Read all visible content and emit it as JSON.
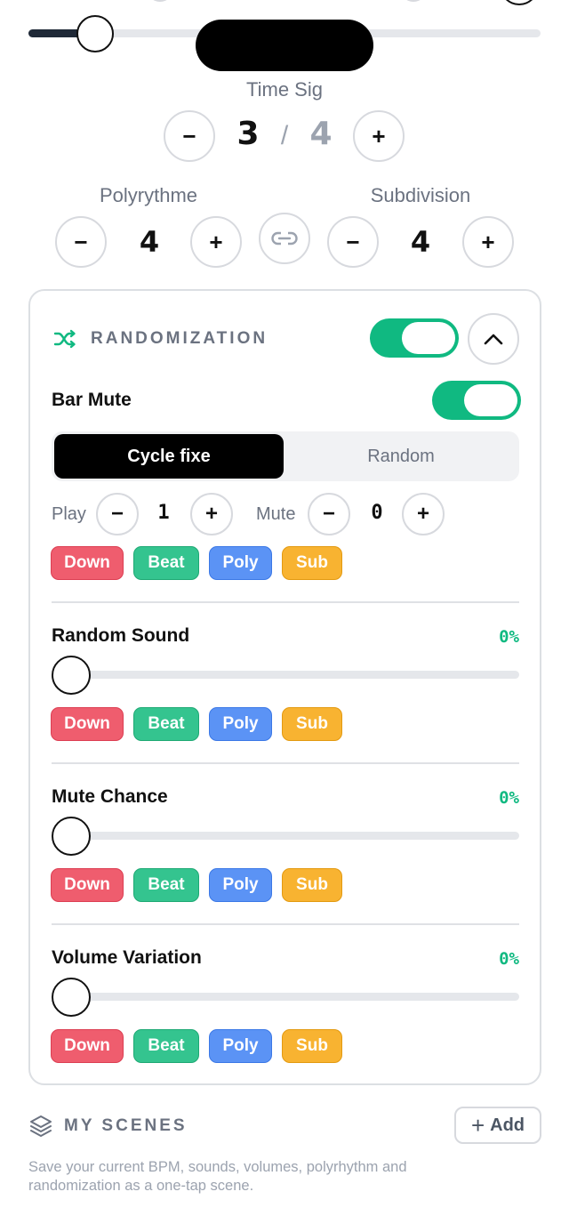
{
  "tempo": {
    "slider_value": 0.12
  },
  "time_sig": {
    "label": "Time Sig",
    "numerator": "3",
    "slash": "/",
    "denominator": "4",
    "minus": "−",
    "plus": "+"
  },
  "polyrythme": {
    "label": "Polyrythme",
    "value": "4",
    "minus": "−",
    "plus": "+"
  },
  "subdivision": {
    "label": "Subdivision",
    "value": "4",
    "minus": "−",
    "plus": "+"
  },
  "randomization": {
    "title": "RANDOMIZATION",
    "enabled": true,
    "bar_mute": {
      "label": "Bar Mute",
      "enabled": true,
      "modes": [
        "Cycle fixe",
        "Random"
      ],
      "selected_mode": "Cycle fixe",
      "play_label": "Play",
      "play_value": "1",
      "mute_label": "Mute",
      "mute_value": "0",
      "minus": "−",
      "plus": "+",
      "chips": [
        "Down",
        "Beat",
        "Poly",
        "Sub"
      ]
    },
    "random_sound": {
      "label": "Random Sound",
      "percent": "0%",
      "value": 0,
      "chips": [
        "Down",
        "Beat",
        "Poly",
        "Sub"
      ]
    },
    "mute_chance": {
      "label": "Mute Chance",
      "percent": "0%",
      "value": 0,
      "chips": [
        "Down",
        "Beat",
        "Poly",
        "Sub"
      ]
    },
    "volume_variation": {
      "label": "Volume Variation",
      "percent": "0%",
      "value": 0,
      "chips": [
        "Down",
        "Beat",
        "Poly",
        "Sub"
      ]
    }
  },
  "scenes": {
    "title": "MY SCENES",
    "add_label": "Add",
    "add_plus": "+",
    "description": "Save your current BPM, sounds, volumes, polyrhythm and randomization as a one-tap scene."
  },
  "icons": {
    "shuffle": "shuffle-icon",
    "chevron_up": "chevron-up-icon",
    "link": "link-icon",
    "layers": "layers-icon",
    "plus": "plus-icon"
  },
  "colors": {
    "accent_green": "#10b981",
    "chip_down": "#ef5d6e",
    "chip_beat": "#34c48f",
    "chip_poly": "#5b93f5",
    "chip_sub": "#f8b331"
  }
}
